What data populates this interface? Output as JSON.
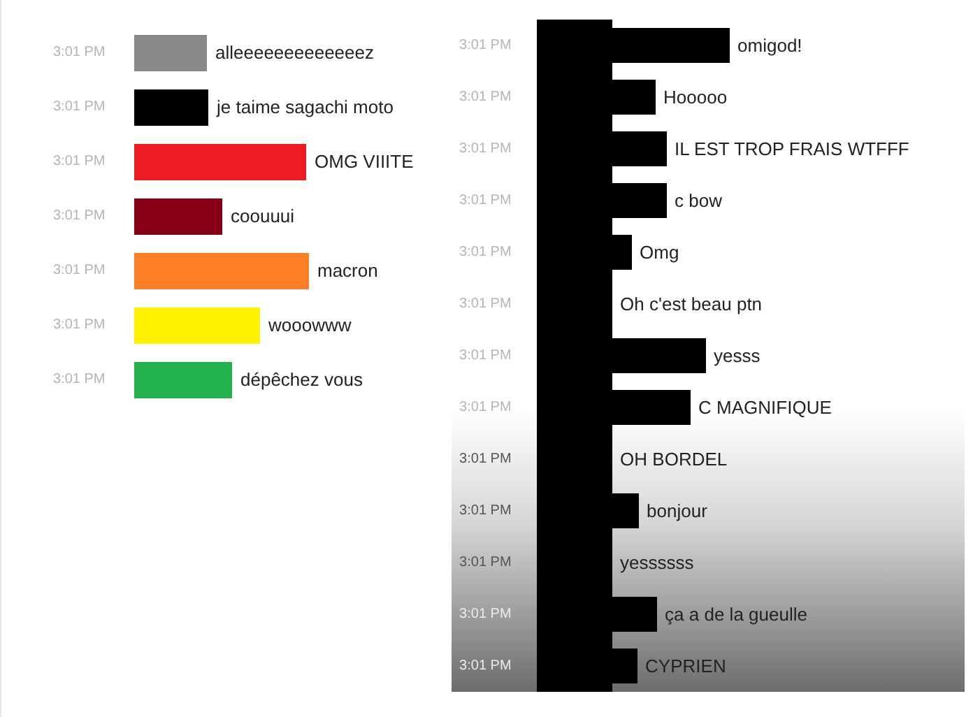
{
  "left_messages": [
    {
      "time": "3:01 PM",
      "color": "#888888",
      "text": "alleeeeeeeeeeeeez"
    },
    {
      "time": "3:01 PM",
      "color": "#000000",
      "text": "je taime sagachi moto"
    },
    {
      "time": "3:01 PM",
      "color": "#ed1c24",
      "text": "OMG VIIITE"
    },
    {
      "time": "3:01 PM",
      "color": "#880015",
      "text": "coouuui"
    },
    {
      "time": "3:01 PM",
      "color": "#ff7f27",
      "text": "macron"
    },
    {
      "time": "3:01 PM",
      "color": "#fff200",
      "text": "wooowww"
    },
    {
      "time": "3:01 PM",
      "color": "#22b14c",
      "text": "dépêchez vous"
    }
  ],
  "right_messages": [
    {
      "time": "3:01 PM",
      "text": "omigod!"
    },
    {
      "time": "3:01 PM",
      "text": "Hooooo"
    },
    {
      "time": "3:01 PM",
      "text": "IL EST TROP FRAIS WTFFF"
    },
    {
      "time": "3:01 PM",
      "text": "c bow"
    },
    {
      "time": "3:01 PM",
      "text": "Omg"
    },
    {
      "time": "3:01 PM",
      "text": "Oh c'est beau ptn"
    },
    {
      "time": "3:01 PM",
      "text": "yesss"
    },
    {
      "time": "3:01 PM",
      "text": "C MAGNIFIQUE"
    },
    {
      "time": "3:01 PM",
      "text": "OH BORDEL"
    },
    {
      "time": "3:01 PM",
      "text": "bonjour"
    },
    {
      "time": "3:01 PM",
      "text": "yessssss"
    },
    {
      "time": "3:01 PM",
      "text": "ça a de la gueulle"
    },
    {
      "time": "3:01 PM",
      "text": "CYPRIEN"
    }
  ]
}
